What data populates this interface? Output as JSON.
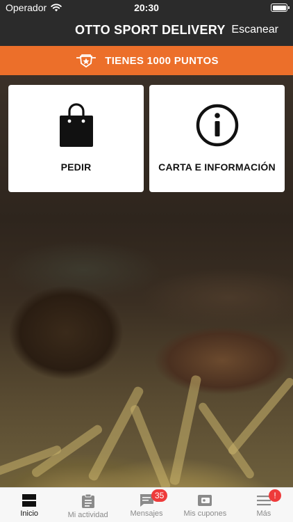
{
  "status_bar": {
    "carrier": "Operador",
    "time": "20:30"
  },
  "navbar": {
    "title": "OTTO SPORT DELIVERY",
    "action": "Escanear"
  },
  "points_banner": {
    "text": "TIENES 1000 PUNTOS"
  },
  "cards": [
    {
      "label": "PEDIR",
      "icon": "shopping-bag-icon"
    },
    {
      "label": "CARTA E INFORMACIÓN",
      "icon": "info-icon"
    }
  ],
  "tabbar": {
    "tabs": [
      {
        "label": "Inicio",
        "icon": "home-icon",
        "active": true
      },
      {
        "label": "Mi actividad",
        "icon": "clipboard-icon"
      },
      {
        "label": "Mensajes",
        "icon": "message-icon",
        "badge": "35"
      },
      {
        "label": "Mis cupones",
        "icon": "wallet-icon"
      },
      {
        "label": "Más",
        "icon": "menu-icon",
        "badge": "!"
      }
    ]
  },
  "colors": {
    "accent": "#ec6f2a",
    "navbar": "#2b2b2b",
    "badge": "#ee3b3b"
  }
}
